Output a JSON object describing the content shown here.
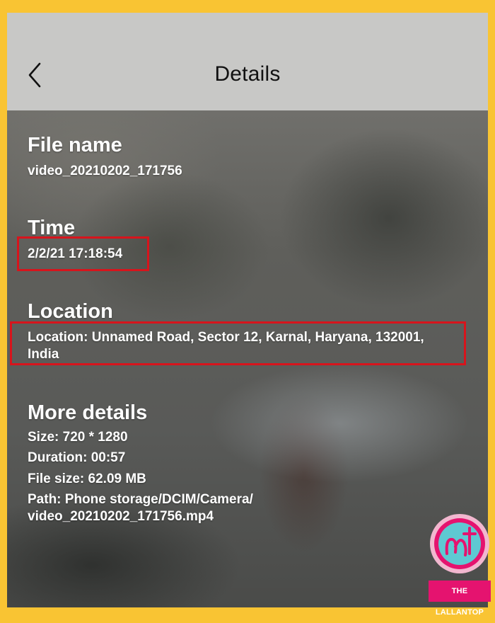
{
  "header": {
    "title": "Details"
  },
  "file_name": {
    "heading": "File name",
    "value": "video_20210202_171756"
  },
  "time": {
    "heading": "Time",
    "value": "2/2/21 17:18:54"
  },
  "location": {
    "heading": "Location",
    "line1": "Location: Unnamed Road, Sector 12, Karnal, Haryana, 132001,",
    "line2": "India"
  },
  "more_details": {
    "heading": "More details",
    "size": "Size: 720 * 1280",
    "duration": "Duration: 00:57",
    "file_size": "File size: 62.09 MB",
    "path_line1": "Path: Phone storage/DCIM/Camera/",
    "path_line2": "video_20210202_171756.mp4"
  },
  "watermark": {
    "label": "THE LALLANTOP",
    "icon": "lallantop-logo"
  },
  "colors": {
    "frame": "#f9c433",
    "highlight": "#d7141c",
    "logo_pink": "#e5136f",
    "logo_teal": "#5ec9d2"
  }
}
